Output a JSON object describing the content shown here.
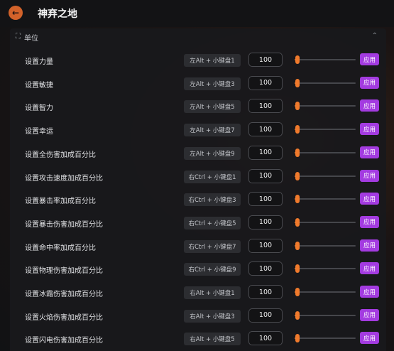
{
  "header": {
    "title": "神弃之地",
    "back_icon": "arrow-left-icon",
    "back_glyph": "←"
  },
  "section": {
    "title": "单位",
    "icon_glyph": "⛶",
    "collapse_glyph": "⌃"
  },
  "colors": {
    "accent": "#d2622a",
    "apply": "#a33be0",
    "slider": "#f07a2c"
  },
  "rows": [
    {
      "label": "设置力量",
      "hotkey": "左Alt + 小键盘1",
      "value": "100",
      "apply": "应用",
      "slider_fraction": 0.0
    },
    {
      "label": "设置敏捷",
      "hotkey": "左Alt + 小键盘3",
      "value": "100",
      "apply": "应用",
      "slider_fraction": 0.0
    },
    {
      "label": "设置智力",
      "hotkey": "左Alt + 小键盘5",
      "value": "100",
      "apply": "应用",
      "slider_fraction": 0.0
    },
    {
      "label": "设置幸运",
      "hotkey": "左Alt + 小键盘7",
      "value": "100",
      "apply": "应用",
      "slider_fraction": 0.0
    },
    {
      "label": "设置全伤害加成百分比",
      "hotkey": "左Alt + 小键盘9",
      "value": "100",
      "apply": "应用",
      "slider_fraction": 0.0
    },
    {
      "label": "设置攻击速度加成百分比",
      "hotkey": "右Ctrl + 小键盘1",
      "value": "100",
      "apply": "应用",
      "slider_fraction": 0.0
    },
    {
      "label": "设置暴击率加成百分比",
      "hotkey": "右Ctrl + 小键盘3",
      "value": "100",
      "apply": "应用",
      "slider_fraction": 0.0
    },
    {
      "label": "设置暴击伤害加成百分比",
      "hotkey": "右Ctrl + 小键盘5",
      "value": "100",
      "apply": "应用",
      "slider_fraction": 0.0
    },
    {
      "label": "设置命中率加成百分比",
      "hotkey": "右Ctrl + 小键盘7",
      "value": "100",
      "apply": "应用",
      "slider_fraction": 0.0
    },
    {
      "label": "设置物理伤害加成百分比",
      "hotkey": "右Ctrl + 小键盘9",
      "value": "100",
      "apply": "应用",
      "slider_fraction": 0.0
    },
    {
      "label": "设置冰霜伤害加成百分比",
      "hotkey": "右Alt + 小键盘1",
      "value": "100",
      "apply": "应用",
      "slider_fraction": 0.0
    },
    {
      "label": "设置火焰伤害加成百分比",
      "hotkey": "右Alt + 小键盘3",
      "value": "100",
      "apply": "应用",
      "slider_fraction": 0.0
    },
    {
      "label": "设置闪电伤害加成百分比",
      "hotkey": "右Alt + 小键盘5",
      "value": "100",
      "apply": "应用",
      "slider_fraction": 0.0
    }
  ]
}
